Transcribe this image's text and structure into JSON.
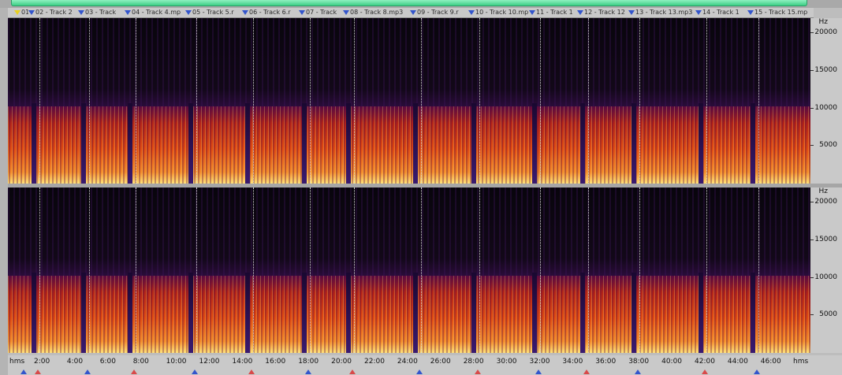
{
  "markers": [
    "01 -",
    "02 - Track  2",
    "03 - Track",
    "04 - Track  4.mp",
    "05 - Track  5.r",
    "06 - Track  6.r",
    "07 - Track",
    "08 - Track  8.mp3",
    "09 - Track  9.r",
    "10 - Track 10.mp",
    "11 - Track 1",
    "12 - Track 12",
    "13 - Track 13.mp3",
    "14 - Track 1",
    "15 - Track 15.mp"
  ],
  "freq_axis": {
    "unit": "Hz",
    "ticks": [
      "20000",
      "15000",
      "10000",
      "5000"
    ]
  },
  "time_axis": {
    "unit": "hms",
    "ticks": [
      "2:00",
      "4:00",
      "6:00",
      "8:00",
      "10:00",
      "12:00",
      "14:00",
      "16:00",
      "18:00",
      "20:00",
      "22:00",
      "24:00",
      "26:00",
      "28:00",
      "30:00",
      "32:00",
      "34:00",
      "36:00",
      "38:00",
      "40:00",
      "42:00",
      "44:00",
      "46:00"
    ]
  },
  "colors": {
    "low": "#050308",
    "mid": "#7a1040",
    "high": "#e24a14",
    "peak": "#ffe070",
    "marker": "#3355cc"
  }
}
